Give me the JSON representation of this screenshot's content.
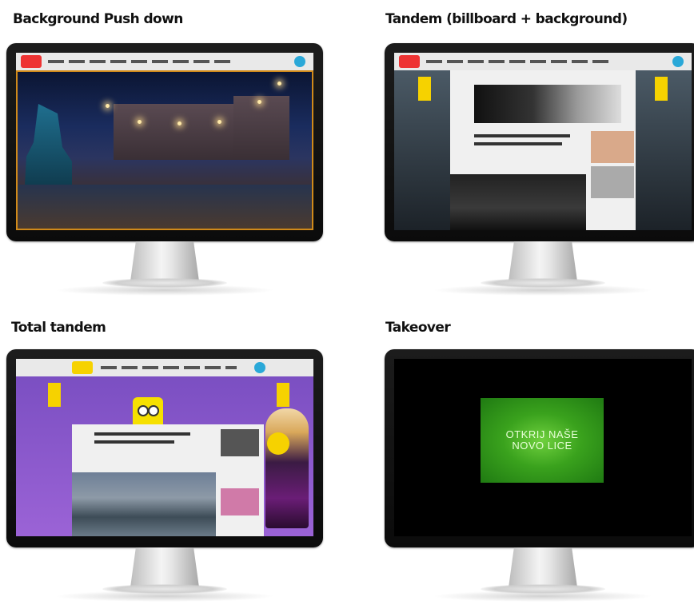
{
  "panels": [
    {
      "heading": "Background Push down",
      "screen": "night-city-background"
    },
    {
      "heading": "Tandem (billboard + background)",
      "screen": "tandem-layout"
    },
    {
      "heading": "Total tandem",
      "screen": "total-tandem-layout"
    },
    {
      "heading": "Takeover",
      "screen": "takeover-ad",
      "ad_text": "OTKRIJ NAŠE NOVO LICE"
    }
  ],
  "colors": {
    "accent_orange": "#d08a1a",
    "purple_background": "#8a5acb",
    "takeover_green": "#3aa21d",
    "mascot_yellow": "#f6e000"
  }
}
